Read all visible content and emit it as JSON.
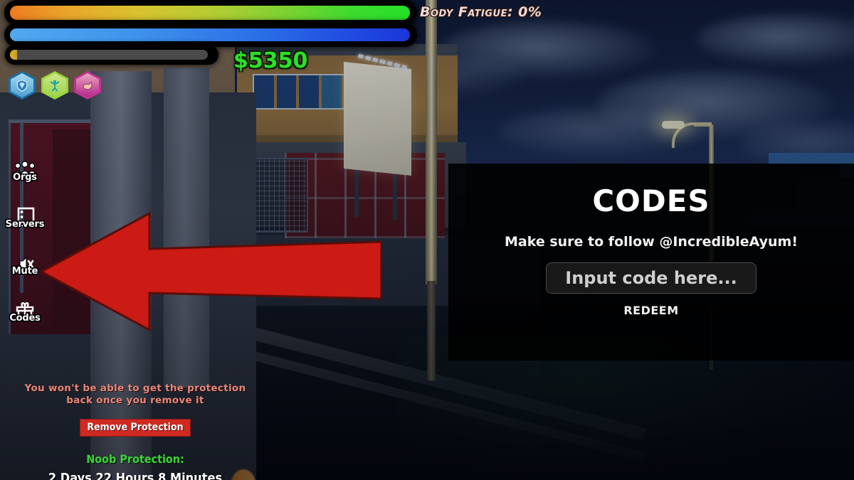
{
  "hud": {
    "health_bar": {
      "name": "health-bar",
      "fill_percent": 99,
      "colors": [
        "#ef7a22",
        "#d8c22f",
        "#25e028"
      ]
    },
    "stamina_bar": {
      "name": "stamina-bar",
      "fill_percent": 99,
      "colors": [
        "#52a8ef",
        "#1b37d8"
      ]
    },
    "xp_bar": {
      "name": "xp-bar",
      "fill_percent": 4,
      "colors": [
        "#e0b431",
        "#4a4a4a"
      ]
    },
    "fatigue_label": "Body Fatigue: 0%",
    "money": "$5350",
    "money_color": "#2fdf2a",
    "abilities": [
      {
        "name": "shield-ability",
        "icon": "shield-icon",
        "glyph": "◆",
        "color": "#4e9fd0"
      },
      {
        "name": "agility-ability",
        "icon": "figure-icon",
        "glyph": "❄",
        "color": "#9bd14b"
      },
      {
        "name": "strength-ability",
        "icon": "flex-arm-icon",
        "glyph": "◗",
        "color": "#b3248b"
      }
    ]
  },
  "side_menu": {
    "items": [
      {
        "label": "Orgs",
        "icon": "people-group-icon",
        "name": "sidebar-item-orgs"
      },
      {
        "label": "Servers",
        "icon": "server-grid-icon",
        "name": "sidebar-item-servers"
      },
      {
        "label": "Mute",
        "icon": "mute-speaker-icon",
        "name": "sidebar-item-mute"
      },
      {
        "label": "Codes",
        "icon": "gift-box-icon",
        "name": "sidebar-item-codes"
      }
    ]
  },
  "annotation": {
    "arrow": {
      "name": "red-pointer-arrow",
      "direction": "left",
      "color": "#cc1a14"
    }
  },
  "codes_panel": {
    "title": "CODES",
    "subtitle": "Make sure to follow @IncredibleAyum!",
    "input_placeholder": "Input code here...",
    "input_value": "",
    "redeem_label": "REDEEM",
    "background_color": "#000000"
  },
  "protection": {
    "warning_line_1": "You won't be able to get the protection",
    "warning_line_2": "back once you remove it",
    "warning_color": "#e4877a",
    "remove_button_label": "Remove Protection",
    "remove_button_color": "#cf2a22",
    "noob_title": "Noob Protection:",
    "noob_title_color": "#3fd13a",
    "noob_time": "2 Days 22 Hours 8 Minutes"
  }
}
